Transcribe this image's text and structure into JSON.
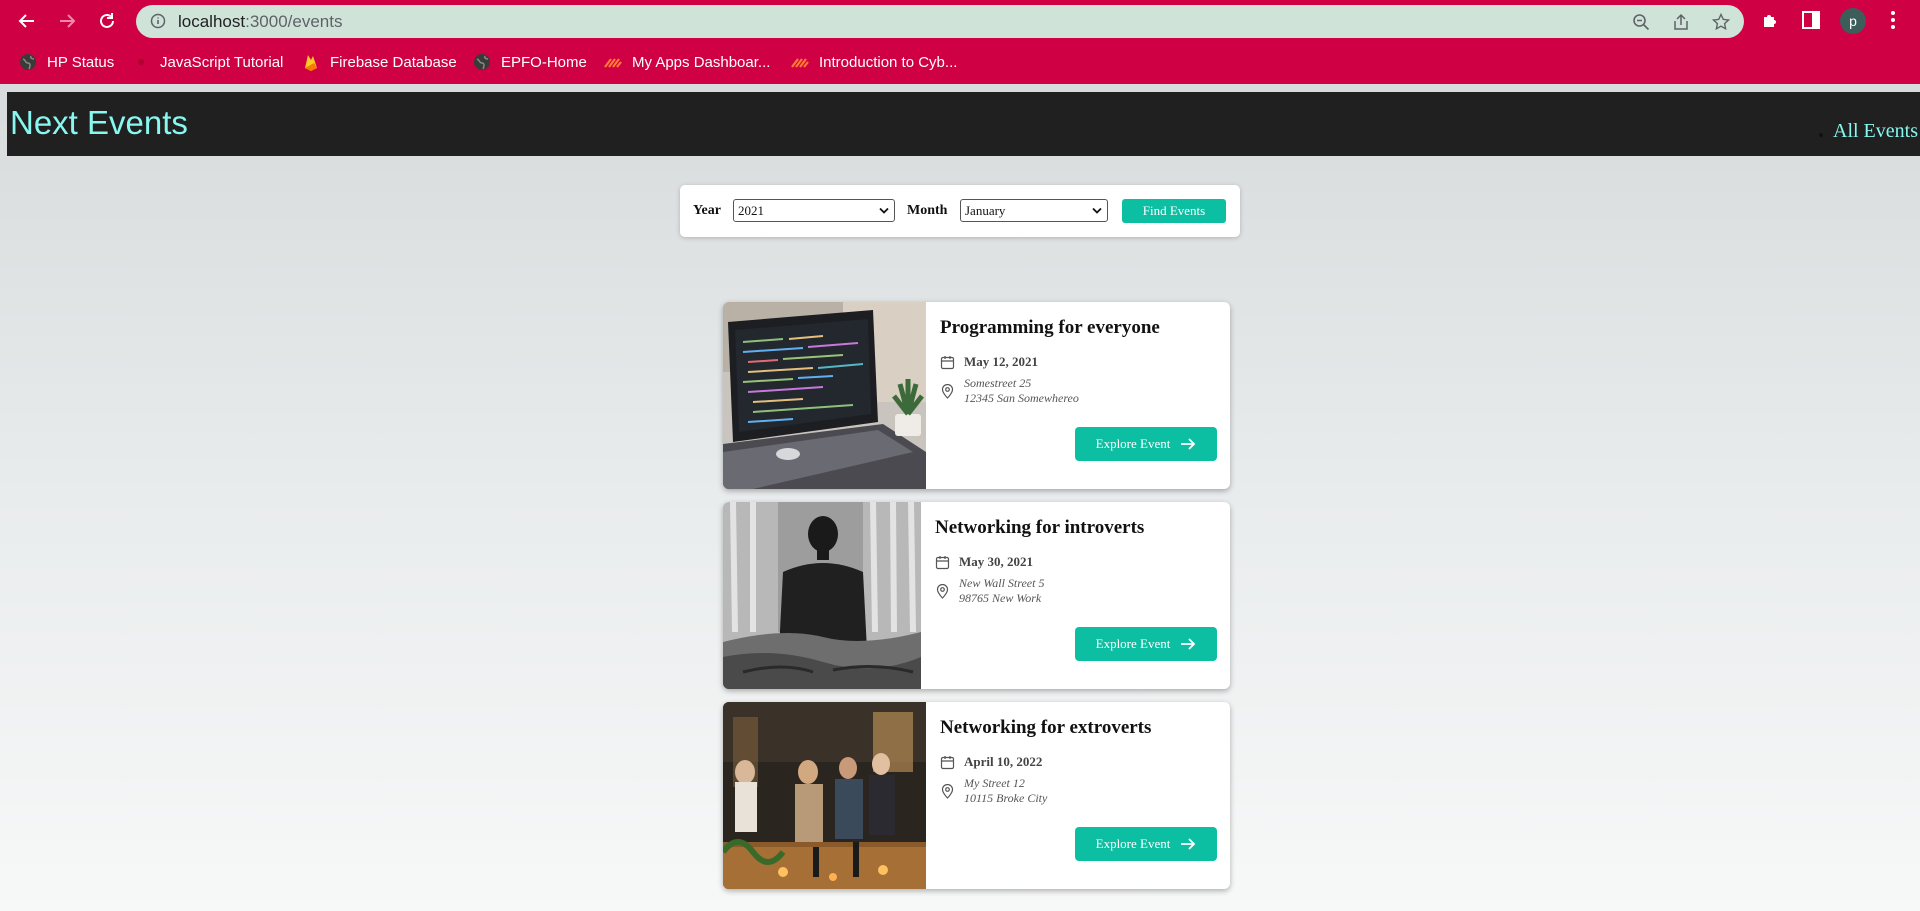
{
  "browser": {
    "url_host": "localhost",
    "url_path": ":3000/events",
    "profile_initial": "p",
    "bookmarks": [
      {
        "label": "HP Status",
        "icon": "globe-icon"
      },
      {
        "label": "JavaScript Tutorial",
        "icon": "site-icon"
      },
      {
        "label": "Firebase Database",
        "icon": "firebase-icon"
      },
      {
        "label": "EPFO-Home",
        "icon": "globe-icon"
      },
      {
        "label": "My Apps Dashboar...",
        "icon": "apps-icon"
      },
      {
        "label": "Introduction to Cyb...",
        "icon": "apps-icon"
      }
    ]
  },
  "header": {
    "logo": "Next Events",
    "nav_all_events": "All Events"
  },
  "filter": {
    "year_label": "Year",
    "year_value": "2021",
    "month_label": "Month",
    "month_value": "January",
    "submit_label": "Find Events"
  },
  "events": [
    {
      "title": "Programming for everyone",
      "date": "May 12, 2021",
      "address_line1": "Somestreet 25",
      "address_line2": "12345 San Somewhereo",
      "button_label": "Explore Event"
    },
    {
      "title": "Networking for introverts",
      "date": "May 30, 2021",
      "address_line1": "New Wall Street 5",
      "address_line2": "98765 New Work",
      "button_label": "Explore Event"
    },
    {
      "title": "Networking for extroverts",
      "date": "April 10, 2022",
      "address_line1": "My Street 12",
      "address_line2": "10115 Broke City",
      "button_label": "Explore Event"
    }
  ],
  "colors": {
    "chrome": "#cf0044",
    "accent": "#0dbfa2",
    "logo": "#88f7ef",
    "header_bg": "#202020"
  }
}
